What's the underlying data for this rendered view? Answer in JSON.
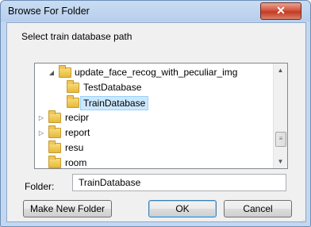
{
  "dialog": {
    "title": "Browse For Folder",
    "close_glyph": "✕",
    "prompt": "Select train database path"
  },
  "tree": {
    "items": [
      {
        "label": "update_face_recog_with_peculiar_img",
        "expander": "◢",
        "selected": false
      },
      {
        "label": "TestDatabase",
        "expander": "",
        "selected": false
      },
      {
        "label": "TrainDatabase",
        "expander": "",
        "selected": true
      },
      {
        "label": "recipr",
        "expander": "▷",
        "selected": false
      },
      {
        "label": "report",
        "expander": "▷",
        "selected": false
      },
      {
        "label": "resu",
        "expander": "",
        "selected": false
      },
      {
        "label": "room",
        "expander": "",
        "selected": false
      }
    ],
    "scroll_up_glyph": "▲",
    "scroll_down_glyph": "▼",
    "thumb_glyph": "≡"
  },
  "folder": {
    "label": "Folder:",
    "value": "TrainDatabase"
  },
  "buttons": {
    "make_new_folder": "Make New Folder",
    "ok": "OK",
    "cancel": "Cancel"
  },
  "colors": {
    "selection": "#cce8ff",
    "close_button": "#c23b22",
    "folder": "#e8b83a"
  }
}
